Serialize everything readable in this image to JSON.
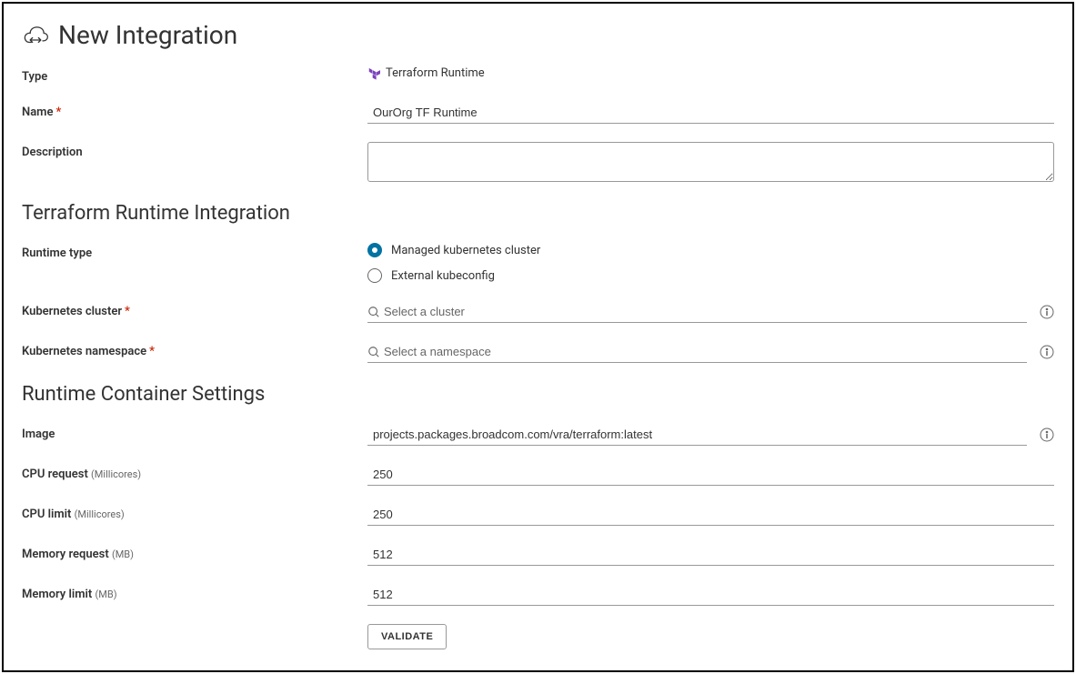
{
  "page": {
    "title": "New Integration"
  },
  "fields": {
    "type": {
      "label": "Type",
      "value": "Terraform Runtime"
    },
    "name": {
      "label": "Name",
      "value": "OurOrg TF Runtime"
    },
    "description": {
      "label": "Description",
      "value": ""
    }
  },
  "sections": {
    "runtime": {
      "title": "Terraform Runtime Integration"
    },
    "container": {
      "title": "Runtime Container Settings"
    }
  },
  "runtime": {
    "type_label": "Runtime type",
    "options": {
      "managed": "Managed kubernetes cluster",
      "external": "External kubeconfig"
    },
    "cluster": {
      "label": "Kubernetes cluster",
      "placeholder": "Select a cluster"
    },
    "namespace": {
      "label": "Kubernetes namespace",
      "placeholder": "Select a namespace"
    }
  },
  "container": {
    "image": {
      "label": "Image",
      "value": "projects.packages.broadcom.com/vra/terraform:latest"
    },
    "cpu_request": {
      "label": "CPU request",
      "unit": "(Millicores)",
      "value": "250"
    },
    "cpu_limit": {
      "label": "CPU limit",
      "unit": "(Millicores)",
      "value": "250"
    },
    "memory_request": {
      "label": "Memory request",
      "unit": "(MB)",
      "value": "512"
    },
    "memory_limit": {
      "label": "Memory limit",
      "unit": "(MB)",
      "value": "512"
    }
  },
  "buttons": {
    "validate": "VALIDATE"
  }
}
